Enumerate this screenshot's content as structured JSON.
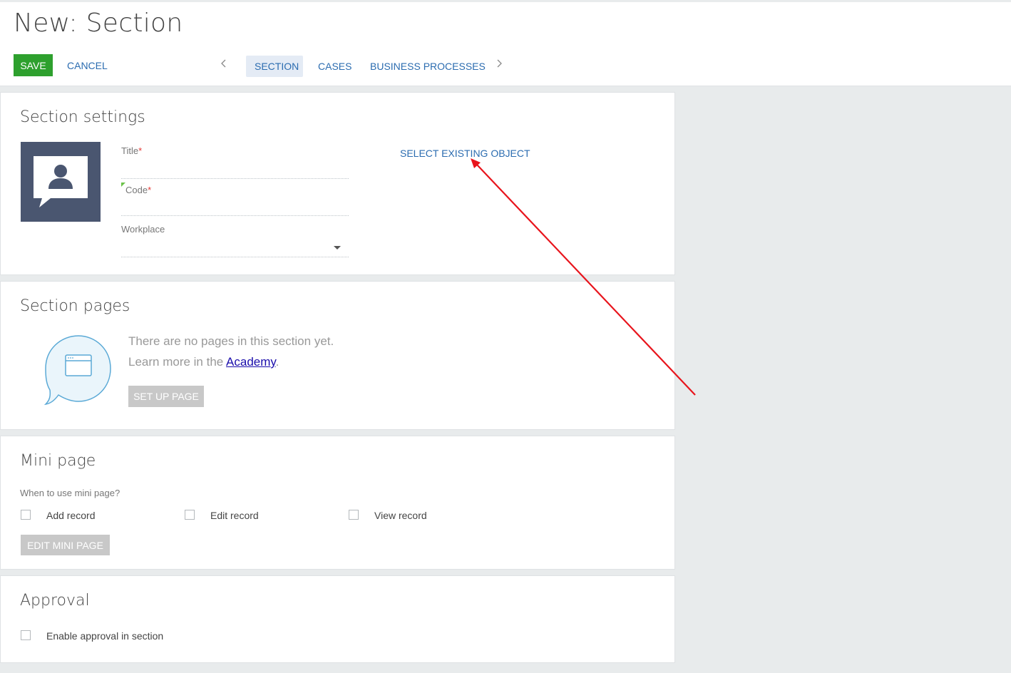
{
  "header": {
    "title": "New: Section",
    "save_label": "SAVE",
    "cancel_label": "CANCEL",
    "prev_icon": "chevron-left-icon",
    "next_icon": "chevron-right-icon",
    "tabs": [
      {
        "label": "SECTION",
        "active": true
      },
      {
        "label": "CASES",
        "active": false
      },
      {
        "label": "BUSINESS PROCESSES",
        "active": false
      }
    ]
  },
  "section_settings": {
    "title": "Section settings",
    "icon": "section-avatar-icon",
    "fields": {
      "title_label": "Title",
      "code_label": "Code",
      "workplace_label": "Workplace",
      "required_mark": "*"
    },
    "select_existing_label": "SELECT EXISTING OBJECT"
  },
  "section_pages": {
    "title": "Section pages",
    "empty_line1": "There are no pages in this section yet.",
    "empty_line2_prefix": "Learn more in the ",
    "academy_link": "Academy",
    "empty_line2_suffix": ".",
    "setup_button": "SET UP PAGE",
    "icon": "page-speech-bubble-icon"
  },
  "mini_page": {
    "title": "Mini page",
    "question": "When to use mini page?",
    "options": [
      {
        "label": "Add record",
        "checked": false
      },
      {
        "label": "Edit record",
        "checked": false
      },
      {
        "label": "View record",
        "checked": false
      }
    ],
    "edit_button": "EDIT MINI PAGE"
  },
  "approval": {
    "title": "Approval",
    "enable_label": "Enable approval in section",
    "checked": false
  },
  "colors": {
    "save_green": "#2ea02e",
    "link_blue": "#2b6cb0",
    "annotation_red": "#e8141c",
    "icon_slate": "#4a5670"
  }
}
